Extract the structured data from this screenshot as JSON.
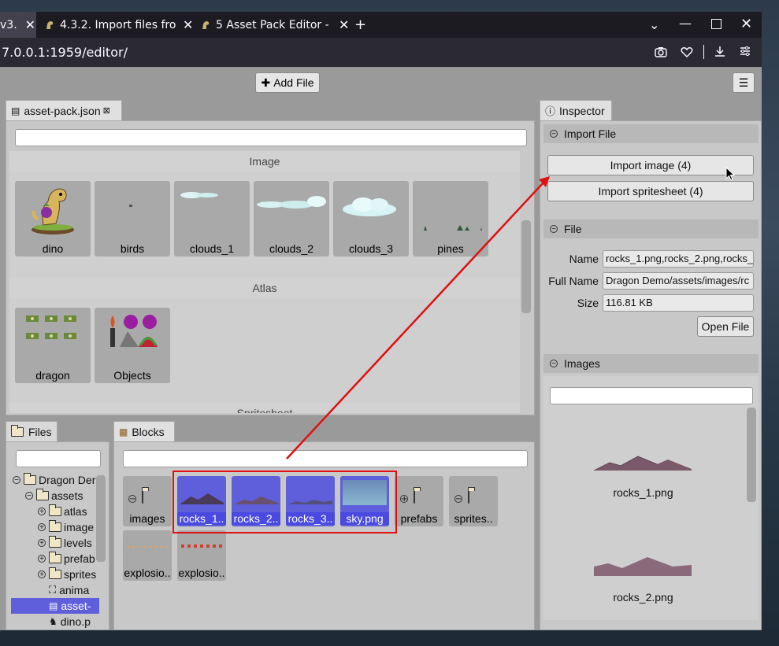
{
  "browser": {
    "tabs": [
      {
        "label": "v3."
      },
      {
        "label": "4.3.2. Import files fro"
      },
      {
        "label": "5  Asset Pack Editor -"
      }
    ],
    "new_tab_label": "+",
    "address": {
      "host": "7.0.0.1",
      "path": ":1959/editor/"
    }
  },
  "toolbar": {
    "add_file_label": "Add File"
  },
  "asset_pack": {
    "tab_label": "asset-pack.json",
    "sections": [
      {
        "title": "Image",
        "items": [
          "dino",
          "birds",
          "clouds_1",
          "clouds_2",
          "clouds_3",
          "pines"
        ]
      },
      {
        "title": "Atlas",
        "items": [
          "dragon",
          "Objects"
        ]
      },
      {
        "title": "Spritesheet"
      }
    ]
  },
  "files": {
    "tab_label": "Files",
    "tree": [
      {
        "label": "Dragon Der",
        "level": 0,
        "type": "folder",
        "expander": "minus"
      },
      {
        "label": "assets",
        "level": 1,
        "type": "folder",
        "expander": "minus"
      },
      {
        "label": "atlas",
        "level": 2,
        "type": "folder",
        "expander": "plus"
      },
      {
        "label": "image",
        "level": 2,
        "type": "folder",
        "expander": "plus"
      },
      {
        "label": "levels",
        "level": 2,
        "type": "folder",
        "expander": "plus"
      },
      {
        "label": "prefab",
        "level": 2,
        "type": "folder",
        "expander": "plus"
      },
      {
        "label": "sprites",
        "level": 2,
        "type": "folder",
        "expander": "plus"
      },
      {
        "label": "anima",
        "level": 2,
        "type": "file"
      },
      {
        "label": "asset-",
        "level": 2,
        "type": "file",
        "selected": true
      },
      {
        "label": "dino.p",
        "level": 2,
        "type": "file"
      }
    ]
  },
  "blocks": {
    "tab_label": "Blocks",
    "items": [
      {
        "label": "images",
        "kind": "folder"
      },
      {
        "label": "rocks_1..",
        "kind": "image",
        "selected": true
      },
      {
        "label": "rocks_2..",
        "kind": "image",
        "selected": true
      },
      {
        "label": "rocks_3..",
        "kind": "image",
        "selected": true
      },
      {
        "label": "sky.png",
        "kind": "sky",
        "selected": true
      },
      {
        "label": "prefabs",
        "kind": "folder"
      },
      {
        "label": "sprites..",
        "kind": "folder"
      },
      {
        "label": "explosio..",
        "kind": "strip"
      },
      {
        "label": "explosio..",
        "kind": "strip"
      }
    ]
  },
  "inspector": {
    "tab_label": "Inspector",
    "import_section": {
      "title": "Import File",
      "buttons": [
        "Import image (4)",
        "Import spritesheet (4)"
      ]
    },
    "file_section": {
      "title": "File",
      "name_label": "Name",
      "name_value": "rocks_1.png,rocks_2.png,rocks_",
      "fullname_label": "Full Name",
      "fullname_value": "Dragon Demo/assets/images/rc",
      "size_label": "Size",
      "size_value": "116.81 KB",
      "open_file_label": "Open File"
    },
    "images_section": {
      "title": "Images",
      "items": [
        "rocks_1.png",
        "rocks_2.png"
      ]
    }
  },
  "colors": {
    "selection": "#5f5fdc",
    "annotation": "#e01010",
    "panel": "#c8c8c8"
  }
}
